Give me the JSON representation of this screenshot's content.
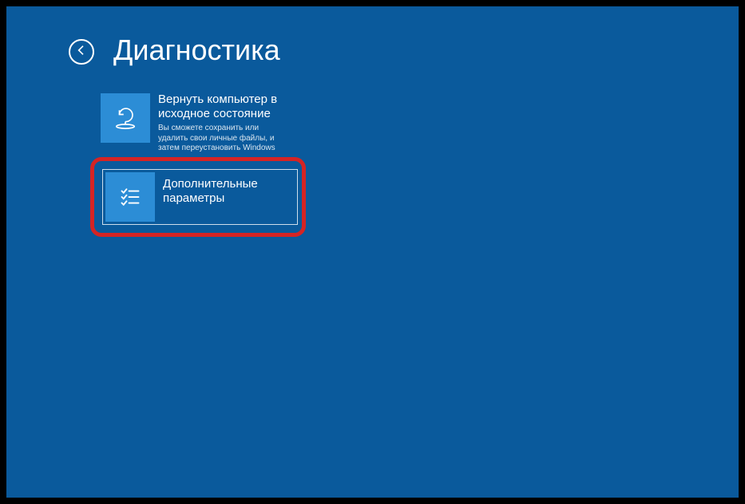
{
  "header": {
    "title": "Диагностика"
  },
  "tiles": {
    "reset": {
      "title": "Вернуть компьютер в исходное состояние",
      "description": "Вы сможете сохранить или удалить свои личные файлы, и затем переустановить Windows"
    },
    "advanced": {
      "title": "Дополнительные параметры"
    }
  }
}
